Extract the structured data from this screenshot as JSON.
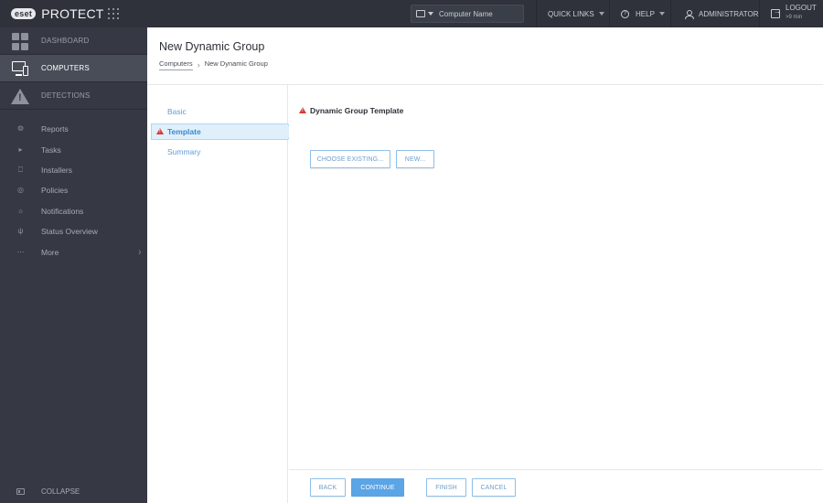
{
  "topbar": {
    "brand_badge": "eset",
    "brand_name": "PROTECT",
    "search_placeholder": "Computer Name",
    "quick_links": "QUICK LINKS",
    "help": "HELP",
    "user": "ADMINISTRATOR",
    "logout": "LOGOUT",
    "logout_timer": ">9 min",
    "icons": {
      "apps": "apps-grid-icon",
      "search_scope": "computer-icon",
      "help": "help-circle-icon",
      "user": "user-icon",
      "logout": "logout-icon"
    }
  },
  "sidebar": {
    "main_items": [
      {
        "label": "DASHBOARD",
        "icon": "dashboard-icon",
        "active": false
      },
      {
        "label": "COMPUTERS",
        "icon": "computers-icon",
        "active": true
      },
      {
        "label": "DETECTIONS",
        "icon": "warning-triangle-icon",
        "active": false
      }
    ],
    "items": [
      {
        "label": "Reports",
        "icon": "reports-icon"
      },
      {
        "label": "Tasks",
        "icon": "tasks-icon"
      },
      {
        "label": "Installers",
        "icon": "installers-icon"
      },
      {
        "label": "Policies",
        "icon": "policies-icon"
      },
      {
        "label": "Notifications",
        "icon": "notifications-icon"
      },
      {
        "label": "Status Overview",
        "icon": "status-overview-icon"
      },
      {
        "label": "More",
        "icon": "more-icon"
      }
    ],
    "collapse": "COLLAPSE"
  },
  "header": {
    "title": "New Dynamic Group",
    "breadcrumb": [
      "Computers",
      "New Dynamic Group"
    ]
  },
  "wizard": {
    "steps": [
      {
        "label": "Basic",
        "state": "default"
      },
      {
        "label": "Template",
        "state": "active-warning"
      },
      {
        "label": "Summary",
        "state": "default"
      }
    ]
  },
  "main": {
    "section_title": "Dynamic Group Template",
    "choose_existing": "CHOOSE EXISTING...",
    "new": "NEW..."
  },
  "footer": {
    "back": "BACK",
    "continue": "CONTINUE",
    "finish": "FINISH",
    "cancel": "CANCEL"
  },
  "colors": {
    "topbar_bg": "#2f323b",
    "sidebar_bg": "#363943",
    "sidebar_active_bg": "#494d58",
    "accent_blue": "#5ba4e5",
    "link_blue": "#5e9bd6",
    "warning_red": "#d83a34",
    "step_active_bg": "#dff0fb"
  }
}
